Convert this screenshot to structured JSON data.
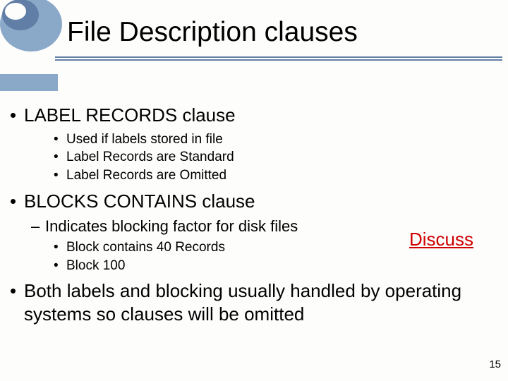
{
  "title": "File Description clauses",
  "bullets": {
    "b1": "LABEL RECORDS clause",
    "b1_sub": {
      "s1": "Used if labels stored in file",
      "s2": "Label Records are Standard",
      "s3": "Label Records are Omitted"
    },
    "b2": "BLOCKS CONTAINS clause",
    "b2_dash": "Indicates blocking factor for disk files",
    "b2_sub": {
      "s1": "Block contains 40 Records",
      "s2": "Block 100"
    },
    "b3": "Both labels and blocking usually handled by operating systems so clauses will be omitted"
  },
  "discuss_label": "Discuss",
  "page_number": "15"
}
